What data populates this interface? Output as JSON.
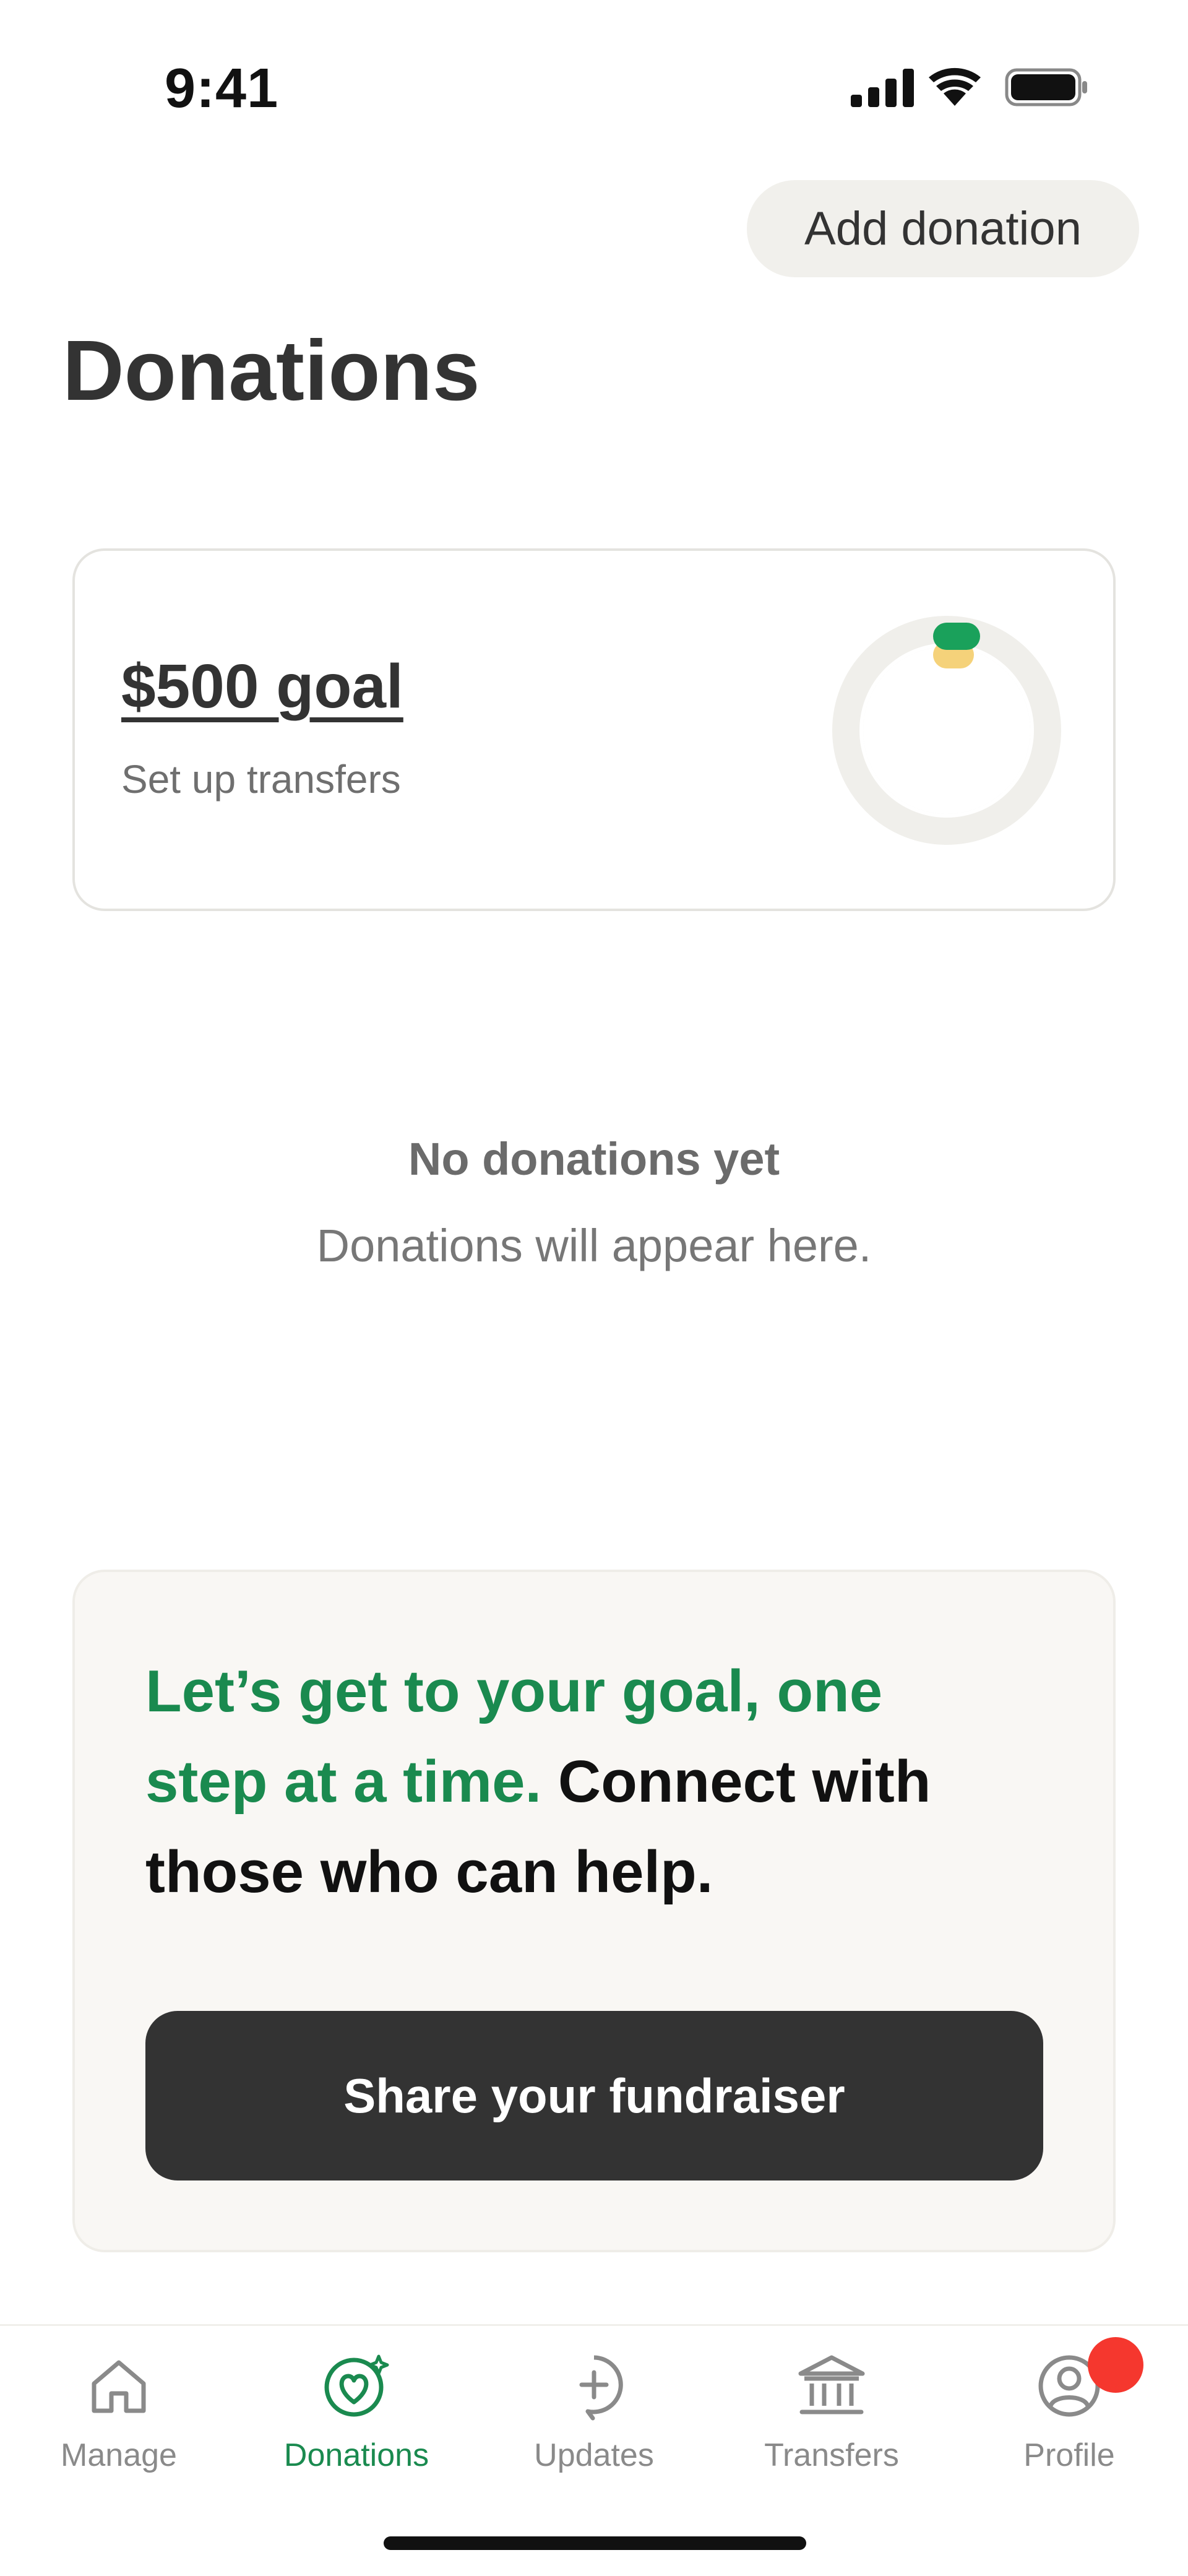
{
  "status_bar": {
    "time": "9:41"
  },
  "header": {
    "add_donation_label": "Add donation",
    "title": "Donations"
  },
  "goal_card": {
    "goal_label": "$500 goal",
    "subtitle": "Set up transfers",
    "accent_green": "#1aa15b",
    "accent_yellow": "#f5d27a"
  },
  "empty_state": {
    "title": "No donations yet",
    "subtitle": "Donations will appear here."
  },
  "promo": {
    "highlight": "Let’s get to your goal, one step at a time.",
    "rest": " Connect with those who can help.",
    "share_label": "Share your fundraiser"
  },
  "tabs": [
    {
      "label": "Manage",
      "icon": "home-icon",
      "active": false
    },
    {
      "label": "Donations",
      "icon": "heart-sparkle-icon",
      "active": true
    },
    {
      "label": "Updates",
      "icon": "plus-bubble-icon",
      "active": false
    },
    {
      "label": "Transfers",
      "icon": "bank-icon",
      "active": false
    },
    {
      "label": "Profile",
      "icon": "profile-icon",
      "active": false,
      "has_badge": true
    }
  ],
  "colors": {
    "brand_green": "#1a8a4f",
    "dark_button": "#333333",
    "badge_red": "#f5372e"
  }
}
